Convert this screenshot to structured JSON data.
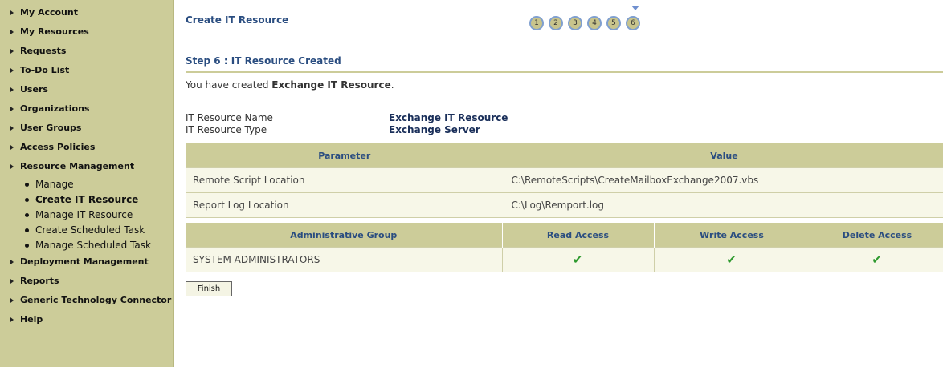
{
  "sidebar": {
    "items": [
      {
        "label": "My Account"
      },
      {
        "label": "My Resources"
      },
      {
        "label": "Requests"
      },
      {
        "label": "To-Do List"
      },
      {
        "label": "Users"
      },
      {
        "label": "Organizations"
      },
      {
        "label": "User Groups"
      },
      {
        "label": "Access Policies"
      },
      {
        "label": "Resource Management"
      },
      {
        "label": "Deployment Management"
      },
      {
        "label": "Reports"
      },
      {
        "label": "Generic Technology Connector"
      },
      {
        "label": "Help"
      }
    ],
    "resource_management_sub": [
      {
        "label": "Manage"
      },
      {
        "label": "Create IT Resource",
        "active": true
      },
      {
        "label": "Manage IT Resource"
      },
      {
        "label": "Create Scheduled Task"
      },
      {
        "label": "Manage Scheduled Task"
      }
    ]
  },
  "page": {
    "title": "Create IT Resource",
    "steps": [
      "1",
      "2",
      "3",
      "4",
      "5",
      "6"
    ],
    "current_step": 6,
    "section_title": "Step 6 : IT Resource Created",
    "message_prefix": "You have created ",
    "message_resource": "Exchange IT Resource",
    "message_suffix": "."
  },
  "properties": [
    {
      "label": "IT Resource Name",
      "value": "Exchange IT Resource"
    },
    {
      "label": "IT Resource Type",
      "value": "Exchange Server"
    }
  ],
  "parameters_table": {
    "headers": [
      "Parameter",
      "Value"
    ],
    "rows": [
      [
        "Remote Script Location",
        "C:\\RemoteScripts\\CreateMailboxExchange2007.vbs"
      ],
      [
        "Report Log Location",
        "C:\\Log\\Remport.log"
      ]
    ]
  },
  "access_table": {
    "headers": [
      "Administrative Group",
      "Read Access",
      "Write Access",
      "Delete Access"
    ],
    "rows": [
      {
        "group": "SYSTEM ADMINISTRATORS",
        "read": "✔",
        "write": "✔",
        "delete": "✔"
      }
    ]
  },
  "buttons": {
    "finish": "Finish"
  },
  "colors": {
    "sidebar_bg": "#cccc99",
    "header_text": "#2a4d80",
    "check": "#2f9a2f"
  }
}
